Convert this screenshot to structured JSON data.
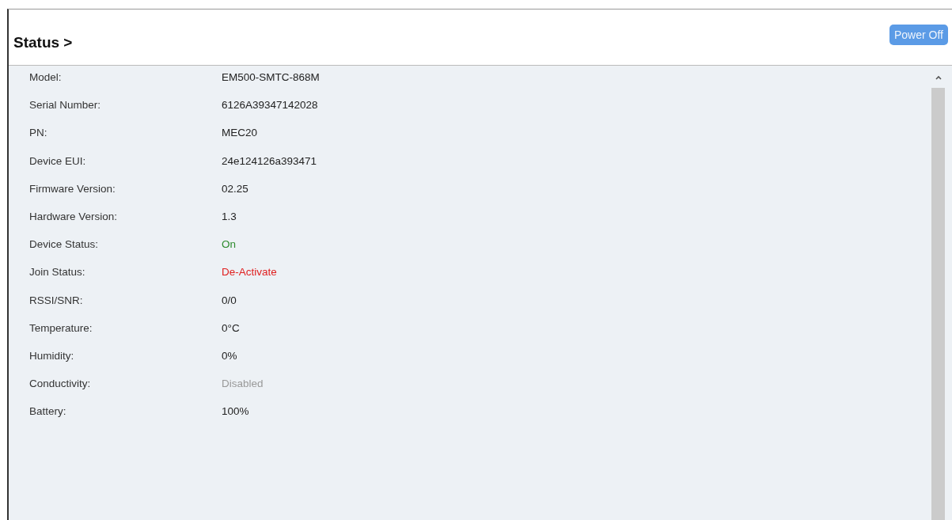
{
  "header": {
    "title": "Status >",
    "power_button": "Power Off"
  },
  "fields": [
    {
      "label": "Model:",
      "value": "EM500-SMTC-868M",
      "color": "#222222"
    },
    {
      "label": "Serial Number:",
      "value": "6126A39347142028",
      "color": "#222222"
    },
    {
      "label": "PN:",
      "value": "MEC20",
      "color": "#222222"
    },
    {
      "label": "Device EUI:",
      "value": "24e124126a393471",
      "color": "#222222"
    },
    {
      "label": "Firmware Version:",
      "value": "02.25",
      "color": "#222222"
    },
    {
      "label": "Hardware Version:",
      "value": "1.3",
      "color": "#222222"
    },
    {
      "label": "Device Status:",
      "value": "On",
      "color": "#2e8b2e"
    },
    {
      "label": "Join Status:",
      "value": "De-Activate",
      "color": "#e02020"
    },
    {
      "label": "RSSI/SNR:",
      "value": "0/0",
      "color": "#222222"
    },
    {
      "label": "Temperature:",
      "value": "0°C",
      "color": "#222222"
    },
    {
      "label": "Humidity:",
      "value": "0%",
      "color": "#222222"
    },
    {
      "label": "Conductivity:",
      "value": "Disabled",
      "color": "#999999"
    },
    {
      "label": "Battery:",
      "value": "100%",
      "color": "#222222"
    }
  ]
}
